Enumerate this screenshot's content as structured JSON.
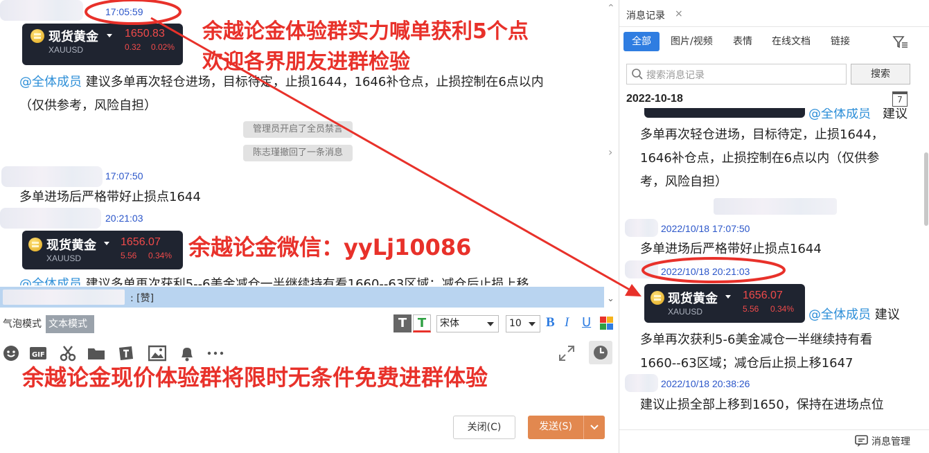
{
  "chat": {
    "messages": [
      {
        "time": "17:05:59"
      },
      {
        "card": {
          "name": "现货黄金",
          "symbol": "XAUUSD",
          "price": "1650.83",
          "change": "0.32",
          "change_pct": "0.02%"
        }
      },
      {
        "mention": "@全体成员",
        "line1": " 建议多单再次轻仓进场，目标待定，止损1644，1646补仓点，止损控制在6点以内",
        "line2": "（仅供参考，风险自担）"
      },
      {
        "system1": "管理员开启了全员禁言",
        "system2": "陈志瑾撤回了一条消息"
      },
      {
        "time": "17:07:50",
        "text": "多单进场后严格带好止损点1644"
      },
      {
        "time": "20:21:03"
      },
      {
        "card": {
          "name": "现货黄金",
          "symbol": "XAUUSD",
          "price": "1656.07",
          "change": "5.56",
          "change_pct": "0.34%"
        }
      },
      {
        "mention": "@全体成员",
        "partial": " 建议多单再次获利5--6美金减仓一半继续持有看1660--63区域；减仓后止损上移"
      }
    ]
  },
  "overlays": {
    "top1": "余越论金体验群实力喊单获利5个点",
    "top2": "欢迎各界朋友进群检验",
    "wechat": "余越论金微信：yyLj10086",
    "bottom": "余越论金现价体验群将限时无条件免费进群体验"
  },
  "reply_bar": {
    "text": ": [赞]"
  },
  "editor": {
    "mode_bubble": "气泡模式",
    "mode_text": "文本模式",
    "font": "宋体",
    "size": "10",
    "close_label": "关闭(C)",
    "send_label": "发送(S)"
  },
  "right_panel": {
    "tab_title": "消息记录",
    "close_x": "×",
    "filter_tabs": [
      "全部",
      "图片/视频",
      "表情",
      "在线文档",
      "链接"
    ],
    "search_placeholder": "搜索消息记录",
    "search_button": "搜索",
    "date": "2022-10-18",
    "calendar_day": "7",
    "items": {
      "top_mention": "@全体成员",
      "top_text": "建议",
      "msg1_l1": "多单再次轻仓进场，目标待定，止损1644，",
      "msg1_l2": "1646补仓点，止损控制在6点以内（仅供参",
      "msg1_l3": "考，风险自担）",
      "time2": "2022/10/18 17:07:50",
      "msg2": "多单进场后严格带好止损点1644",
      "time3": "2022/10/18 20:21:03",
      "card": {
        "name": "现货黄金",
        "symbol": "XAUUSD",
        "price": "1656.07",
        "change": "5.56",
        "change_pct": "0.34%"
      },
      "mention3": "@全体成员",
      "mention3_tail": " 建议",
      "msg3_l1": "多单再次获利5-6美金减仓一半继续持有看",
      "msg3_l2": "1660--63区域；减仓后止损上移1647",
      "time4": "2022/10/18 20:38:26",
      "msg4": "建议止损全部上移到1650，保持在进场点位"
    },
    "footer": "消息管理"
  },
  "colors": {
    "accent": "#2f7de1",
    "annotation_red": "#e8312a",
    "send_orange": "#e2884f"
  }
}
